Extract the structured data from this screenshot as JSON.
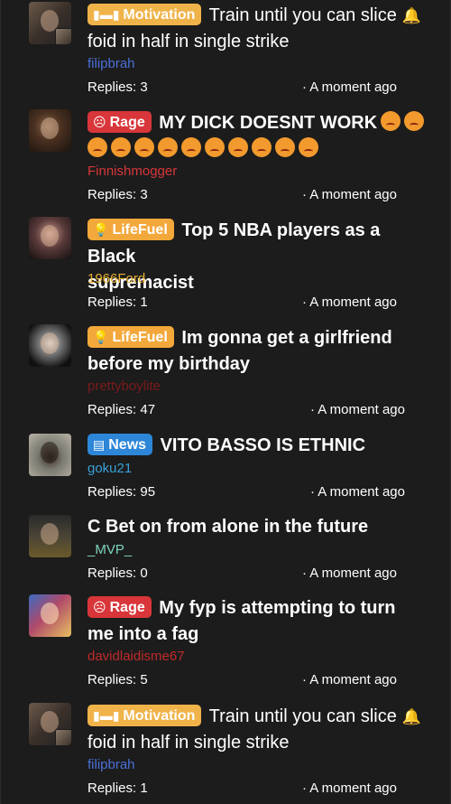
{
  "colors": {
    "background": "#1c1c1c",
    "motivation": "#f0b34a",
    "rage": "#d8363a",
    "lifefuel": "#f3a83b",
    "news": "#2d86d8"
  },
  "threads": [
    {
      "category": "Motivation",
      "category_icon": "dumbbell-icon",
      "title_line1": "Train until you can slice",
      "title_line2": "foid in half in single strike",
      "user": "filipbrah",
      "user_color": "#4a6fd8",
      "replies": "Replies: 3",
      "time": "· A moment ago"
    },
    {
      "category": "Rage",
      "category_icon": "angry-face-icon",
      "title_line1": "MY DICK DOESNT WORK",
      "user": "Finnishmogger",
      "user_color": "#d8363a",
      "replies": "Replies: 3",
      "time": "· A moment ago"
    },
    {
      "category": "LifeFuel",
      "category_icon": "lightbulb-icon",
      "title_line1": "Top 5 NBA players as a Black",
      "title_line2": "supremacist",
      "user": "1966Ford",
      "user_color": "#e8b030",
      "replies": "Replies: 1",
      "time": "· A moment ago"
    },
    {
      "category": "LifeFuel",
      "category_icon": "lightbulb-icon",
      "title_line1": "Im gonna get a girlfriend",
      "title_line2": "before my birthday",
      "user": "prettyboylite",
      "user_color": "#7a1a1a",
      "replies": "Replies: 47",
      "time": "· A moment ago"
    },
    {
      "category": "News",
      "category_icon": "newspaper-icon",
      "title_line1": "VITO BASSO IS ETHNIC",
      "user": "goku21",
      "user_color": "#3aa0d8",
      "replies": "Replies: 95",
      "time": "· A moment ago"
    },
    {
      "category": "",
      "title_line1": "C Bet on from alone in the future",
      "user": "_MVP_",
      "user_color": "#7fd4c0",
      "replies": "Replies: 0",
      "time": "· A moment ago"
    },
    {
      "category": "Rage",
      "category_icon": "angry-face-icon",
      "title_line1": "My fyp is attempting to turn",
      "title_line2": "me into a fag",
      "user": "davidlaidisme67",
      "user_color": "#c02a2a",
      "replies": "Replies: 5",
      "time": "· A moment ago"
    },
    {
      "category": "Motivation",
      "category_icon": "dumbbell-icon",
      "title_line1": "Train until you can slice",
      "title_line2": "foid in half in single strike",
      "user": "filipbrah",
      "user_color": "#4a6fd8",
      "replies": "Replies: 1",
      "time": "· A moment ago"
    }
  ]
}
